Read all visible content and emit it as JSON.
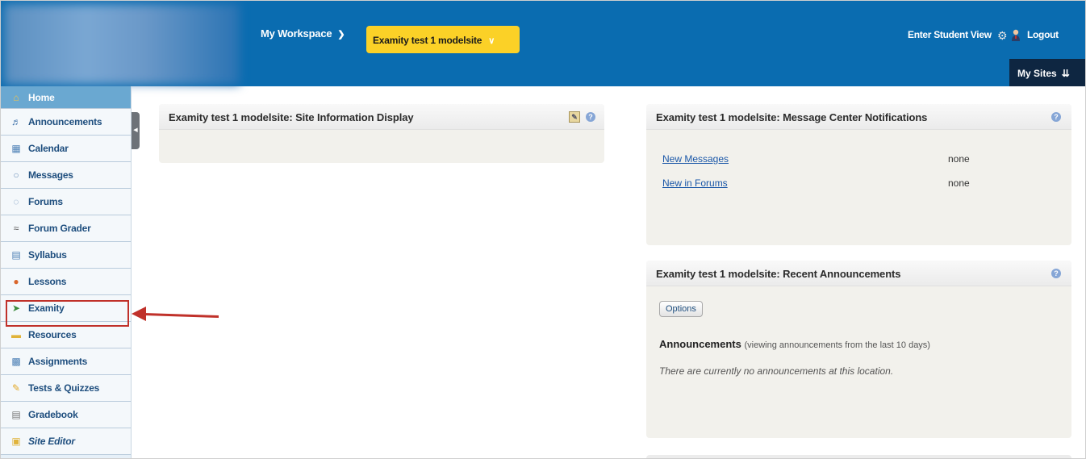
{
  "header": {
    "workspace_label": "My Workspace",
    "site_label": "Examity test 1 modelsite",
    "student_view_label": "Enter Student View",
    "logout_label": "Logout",
    "my_sites_label": "My Sites",
    "colors": {
      "header_bg": "#0a6cb0",
      "site_pill": "#fbd127",
      "my_sites_bg": "#0e2641"
    }
  },
  "sidebar": {
    "items": [
      {
        "label": "Home",
        "icon": "home-icon"
      },
      {
        "label": "Announcements",
        "icon": "megaphone-icon"
      },
      {
        "label": "Calendar",
        "icon": "calendar-icon"
      },
      {
        "label": "Messages",
        "icon": "speech-bubble-icon"
      },
      {
        "label": "Forums",
        "icon": "forum-bubbles-icon"
      },
      {
        "label": "Forum Grader",
        "icon": "grader-icon"
      },
      {
        "label": "Syllabus",
        "icon": "document-icon"
      },
      {
        "label": "Lessons",
        "icon": "lessons-icon"
      },
      {
        "label": "Examity",
        "icon": "examity-icon"
      },
      {
        "label": "Resources",
        "icon": "folder-icon"
      },
      {
        "label": "Assignments",
        "icon": "assignment-icon"
      },
      {
        "label": "Tests & Quizzes",
        "icon": "pencil-icon"
      },
      {
        "label": "Gradebook",
        "icon": "gradebook-icon"
      },
      {
        "label": "Site Editor",
        "icon": "site-editor-icon"
      }
    ],
    "active_index": 0,
    "highlighted_index": 8
  },
  "panels": {
    "site_info": {
      "title": "Examity test 1 modelsite: Site Information Display"
    },
    "message_center": {
      "title": "Examity test 1 modelsite: Message Center Notifications",
      "rows": [
        {
          "label": "New Messages",
          "value": "none"
        },
        {
          "label": "New in Forums",
          "value": "none"
        }
      ]
    },
    "announcements": {
      "title": "Examity test 1 modelsite: Recent Announcements",
      "options_label": "Options",
      "heading": "Announcements",
      "heading_sub": "(viewing announcements from the last 10 days)",
      "empty_text": "There are currently no announcements at this location."
    }
  }
}
